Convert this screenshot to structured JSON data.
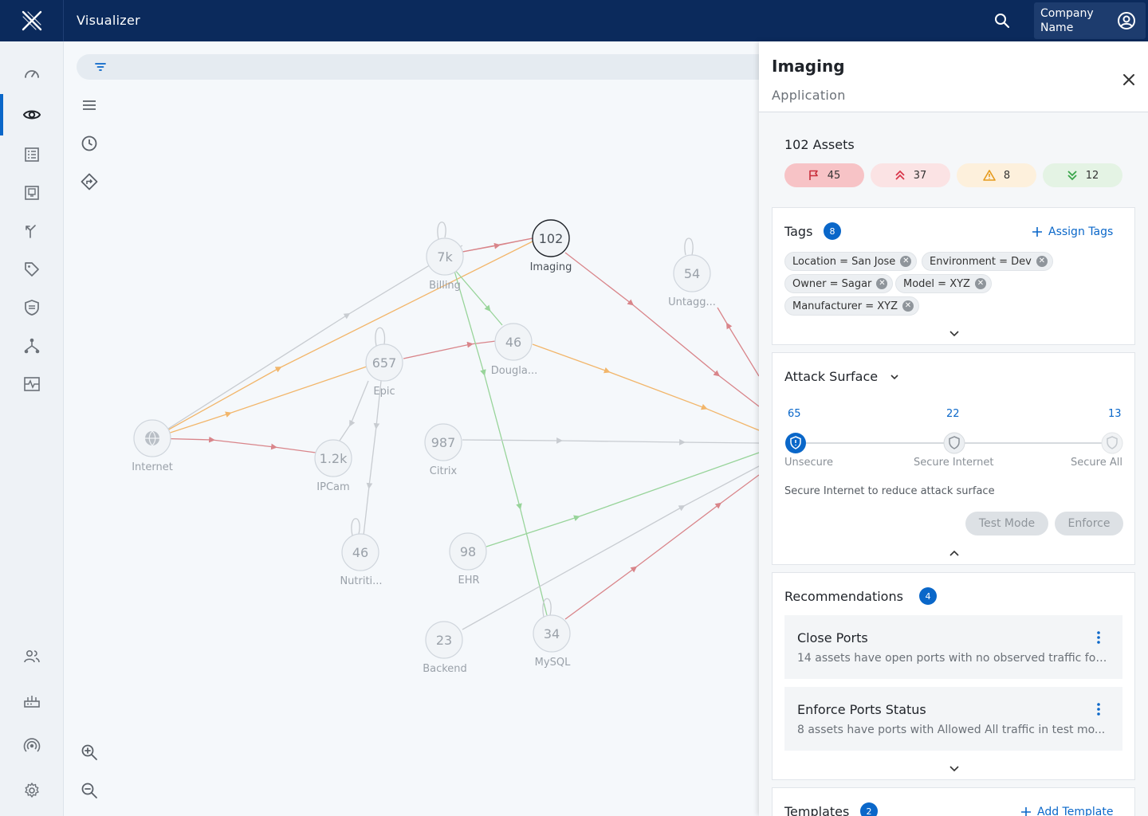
{
  "app": {
    "title": "Visualizer"
  },
  "topbar": {
    "company_name": "Company Name",
    "search_icon": "search-icon",
    "account_icon": "user-circle-icon"
  },
  "sidebar": {
    "items": [
      {
        "name": "dashboard",
        "icon": "speedometer-icon",
        "active": false
      },
      {
        "name": "visualizer",
        "icon": "eye-icon",
        "active": true
      },
      {
        "name": "list",
        "icon": "list-icon",
        "active": false
      },
      {
        "name": "device",
        "icon": "device-icon",
        "active": false
      },
      {
        "name": "paths",
        "icon": "fork-arrow-icon",
        "active": false
      },
      {
        "name": "tags",
        "icon": "tag-icon",
        "active": false
      },
      {
        "name": "security",
        "icon": "shield-icon",
        "active": false
      },
      {
        "name": "network",
        "icon": "topology-icon",
        "active": false
      },
      {
        "name": "monitoring",
        "icon": "pulse-icon",
        "active": false
      }
    ],
    "bottom_items": [
      {
        "name": "users",
        "icon": "users-icon"
      },
      {
        "name": "gateways",
        "icon": "router-icon"
      },
      {
        "name": "broadcast",
        "icon": "broadcast-icon"
      },
      {
        "name": "settings",
        "icon": "gear-icon"
      }
    ]
  },
  "graph": {
    "nodes": [
      {
        "id": "imaging",
        "count": "102",
        "label": "Imaging",
        "selected": true
      },
      {
        "id": "billing",
        "count": "7k",
        "label": "Billing"
      },
      {
        "id": "untagged",
        "count": "54",
        "label": "Untagg..."
      },
      {
        "id": "douglas",
        "count": "46",
        "label": "Dougla..."
      },
      {
        "id": "epic",
        "count": "657",
        "label": "Epic"
      },
      {
        "id": "internet",
        "count": "",
        "label": "Internet"
      },
      {
        "id": "ipcam",
        "count": "1.2k",
        "label": "IPCam"
      },
      {
        "id": "citrix",
        "count": "987",
        "label": "Citrix"
      },
      {
        "id": "nutrition",
        "count": "46",
        "label": "Nutriti..."
      },
      {
        "id": "ehr",
        "count": "98",
        "label": "EHR"
      },
      {
        "id": "backend",
        "count": "23",
        "label": "Backend"
      },
      {
        "id": "mysql",
        "count": "34",
        "label": "MySQL"
      }
    ],
    "colors": {
      "red": "#d9858a",
      "orange": "#f2b66b",
      "green": "#98d49a",
      "gray": "#c8ccd1"
    }
  },
  "panel": {
    "title": "Imaging",
    "subtitle": "Application",
    "assets_title": "102 Assets",
    "risk_pills": [
      {
        "icon": "flag-icon",
        "value": "45",
        "bg": "#f7c3c6",
        "color": "#c9303c"
      },
      {
        "icon": "double-chevron-up-icon",
        "value": "37",
        "bg": "#fbe3e4",
        "color": "#d9364a"
      },
      {
        "icon": "warning-triangle-icon",
        "value": "8",
        "bg": "#fdf0dc",
        "color": "#e59a1c"
      },
      {
        "icon": "double-chevron-down-icon",
        "value": "12",
        "bg": "#e4f3e4",
        "color": "#3aa54a"
      }
    ],
    "tags": {
      "title": "Tags",
      "count": "8",
      "assign_label": "Assign Tags",
      "items": [
        "Location = San Jose",
        "Environment = Dev",
        "Owner = Sagar",
        "Model = XYZ",
        "Manufacturer = XYZ"
      ]
    },
    "attack_surface": {
      "title": "Attack Surface",
      "levels": [
        {
          "count": "65",
          "label": "Unsecure"
        },
        {
          "count": "22",
          "label": "Secure Internet"
        },
        {
          "count": "13",
          "label": "Secure All"
        }
      ],
      "note": "Secure Internet to reduce attack surface",
      "test_mode_label": "Test Mode",
      "enforce_label": "Enforce"
    },
    "recommendations": {
      "title": "Recommendations",
      "count": "4",
      "items": [
        {
          "title": "Close Ports",
          "desc": "14 assets have open ports with no observed traffic for..."
        },
        {
          "title": "Enforce Ports Status",
          "desc": "8 assets have ports with Allowed All traffic in test mo..."
        }
      ]
    },
    "templates": {
      "title": "Templates",
      "count": "2",
      "add_label": "Add Template"
    }
  }
}
